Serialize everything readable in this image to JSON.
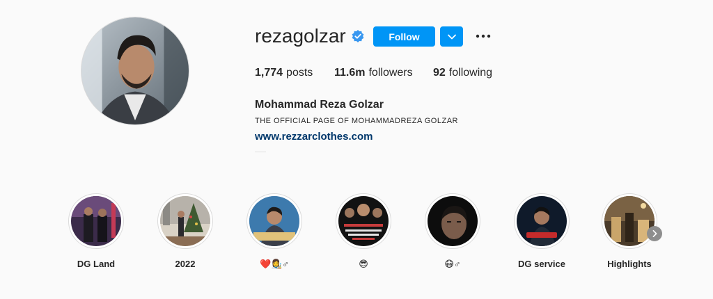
{
  "profile": {
    "username": "rezagolzar",
    "follow_label": "Follow",
    "stats": {
      "posts_count": "1,774",
      "posts_label": "posts",
      "followers_count": "11.6m",
      "followers_label": "followers",
      "following_count": "92",
      "following_label": "following"
    },
    "full_name": "Mohammad Reza Golzar",
    "bio": "THE OFFICIAL PAGE OF MOHAMMADREZA GOLZAR",
    "website": "www.rezzarclothes.com"
  },
  "highlights": [
    {
      "label": "DG Land"
    },
    {
      "label": "2022"
    },
    {
      "label": "❤️👩‍🎨♂"
    },
    {
      "label": "😎"
    },
    {
      "label": "😷♂"
    },
    {
      "label": "DG service"
    },
    {
      "label": "Highlights"
    }
  ],
  "colors": {
    "accent": "#0095f6",
    "link": "#00376b",
    "verified": "#3897f0"
  },
  "icons": [
    "verified-badge-icon",
    "chevron-down-icon",
    "more-options-icon",
    "chevron-right-icon"
  ]
}
